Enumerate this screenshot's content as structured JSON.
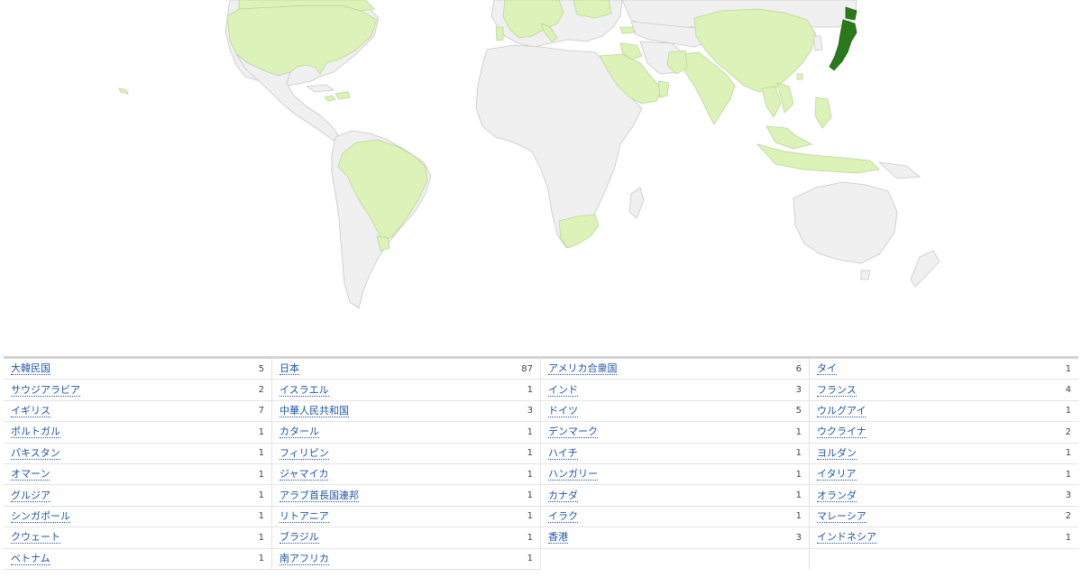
{
  "colors": {
    "base": "#f0f0f0",
    "low": "#dcf2b8",
    "high": "#2a7a1c",
    "link": "#2255a4"
  },
  "columns": [
    [
      {
        "name": "大韓民国",
        "count": "5"
      },
      {
        "name": "サウジアラビア",
        "count": "2"
      },
      {
        "name": "イギリス",
        "count": "7"
      },
      {
        "name": "ポルトガル",
        "count": "1"
      },
      {
        "name": "パキスタン",
        "count": "1"
      },
      {
        "name": "オマーン",
        "count": "1"
      },
      {
        "name": "グルジア",
        "count": "1"
      },
      {
        "name": "シンガポール",
        "count": "1"
      },
      {
        "name": "クウェート",
        "count": "1"
      },
      {
        "name": "ベトナム",
        "count": "1"
      }
    ],
    [
      {
        "name": "日本",
        "count": "87"
      },
      {
        "name": "イスラエル",
        "count": "1"
      },
      {
        "name": "中華人民共和国",
        "count": "3"
      },
      {
        "name": "カタール",
        "count": "1"
      },
      {
        "name": "フィリピン",
        "count": "1"
      },
      {
        "name": "ジャマイカ",
        "count": "1"
      },
      {
        "name": "アラブ首長国連邦",
        "count": "1"
      },
      {
        "name": "リトアニア",
        "count": "1"
      },
      {
        "name": "ブラジル",
        "count": "1"
      },
      {
        "name": "南アフリカ",
        "count": "1"
      }
    ],
    [
      {
        "name": "アメリカ合衆国",
        "count": "6"
      },
      {
        "name": "インド",
        "count": "3"
      },
      {
        "name": "ドイツ",
        "count": "5"
      },
      {
        "name": "デンマーク",
        "count": "1"
      },
      {
        "name": "ハイチ",
        "count": "1"
      },
      {
        "name": "ハンガリー",
        "count": "1"
      },
      {
        "name": "カナダ",
        "count": "1"
      },
      {
        "name": "イラク",
        "count": "1"
      },
      {
        "name": "香港",
        "count": "3"
      }
    ],
    [
      {
        "name": "タイ",
        "count": "1"
      },
      {
        "name": "フランス",
        "count": "4"
      },
      {
        "name": "ウルグアイ",
        "count": "1"
      },
      {
        "name": "ウクライナ",
        "count": "2"
      },
      {
        "name": "ヨルダン",
        "count": "1"
      },
      {
        "name": "イタリア",
        "count": "1"
      },
      {
        "name": "オランダ",
        "count": "3"
      },
      {
        "name": "マレーシア",
        "count": "2"
      },
      {
        "name": "インドネシア",
        "count": "1"
      }
    ]
  ]
}
